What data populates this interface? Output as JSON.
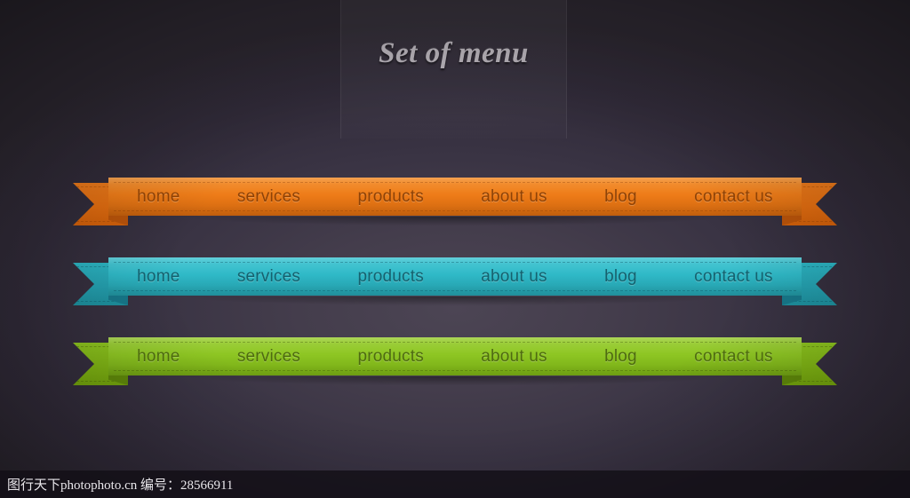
{
  "page": {
    "title": "Set of menu",
    "background_color": "#2e2933",
    "background_center_color": "#4c4554"
  },
  "menu_items": [
    "home",
    "services",
    "products",
    "about us",
    "blog",
    "contact us"
  ],
  "ribbons": [
    {
      "id": "orange",
      "name": "orange-ribbon",
      "color": "#ee7c18",
      "tail_color": "#e06c10",
      "fold_color": "#b8530a",
      "text_color": "#8e4206",
      "items": [
        "home",
        "services",
        "products",
        "about us",
        "blog",
        "contact us"
      ]
    },
    {
      "id": "blue",
      "name": "blue-ribbon",
      "color": "#2fb9c7",
      "tail_color": "#249fae",
      "fold_color": "#17788a",
      "text_color": "#15616e",
      "items": [
        "home",
        "services",
        "products",
        "about us",
        "blog",
        "contact us"
      ]
    },
    {
      "id": "green",
      "name": "green-ribbon",
      "color": "#8ec623",
      "tail_color": "#7eb214",
      "fold_color": "#5e870a",
      "text_color": "#4e6b10",
      "items": [
        "home",
        "services",
        "products",
        "about us",
        "blog",
        "contact us"
      ]
    }
  ],
  "watermark": {
    "text": "图行天下photophoto.cn  编号：28566911"
  }
}
